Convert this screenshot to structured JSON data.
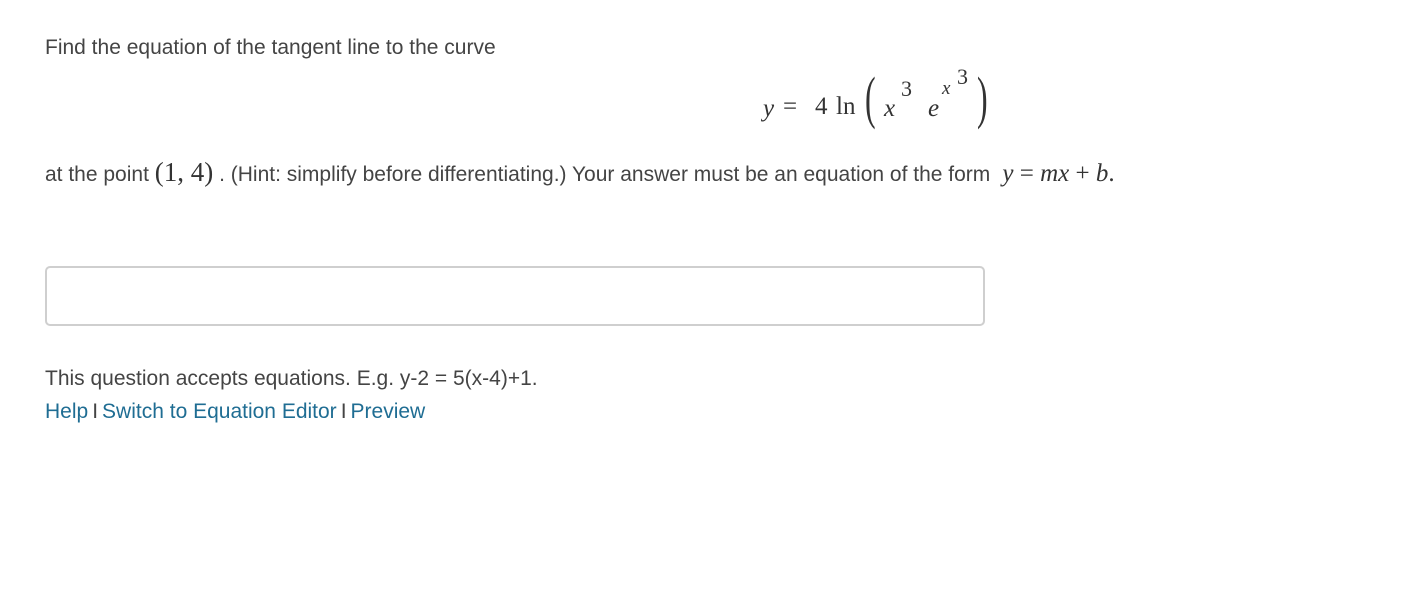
{
  "question": {
    "prompt": "Find the equation of the tangent line to the curve",
    "equation": {
      "lhs": "y",
      "equals": "=",
      "coefficient": "4",
      "func": "ln",
      "base": "x",
      "base_exp": "3",
      "exp_base": "e",
      "exp_exp_var": "x",
      "exp_exp_power": "3"
    },
    "line2_prefix": "at the point",
    "point": "(1, 4)",
    "line2_middle": ". (Hint: simplify before differentiating.)  Your answer must be an equation of the form",
    "form": {
      "y": "y",
      "eq": "=",
      "m": "m",
      "x": "x",
      "plus": "+",
      "b": "b",
      "period": "."
    }
  },
  "answer_field": {
    "value": "",
    "placeholder": ""
  },
  "help": {
    "accepts_text": "This question accepts equations. E.g. y-2 = 5(x-4)+1.",
    "links": {
      "help": "Help",
      "separator": "I",
      "equation_editor": "Switch to Equation Editor",
      "preview": "Preview"
    }
  }
}
